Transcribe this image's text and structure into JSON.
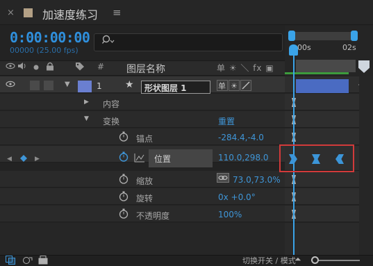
{
  "panel": {
    "close": "×",
    "title": "加速度练习",
    "menu": "≡",
    "timecode": "0:00:00:00",
    "timecode_sub": "00000 (25.00 fps)",
    "search_icon": "search-icon"
  },
  "ruler": {
    "tick_start": "00s",
    "tick_end": "02s"
  },
  "columns": {
    "num": "#",
    "layer_name": "图层名称",
    "switch_icons": "单 ☀ ＼ fx ▣"
  },
  "layer": {
    "number": "1",
    "name": "形状图层 1",
    "label_color": "#6a7fd0"
  },
  "rows": {
    "contents": "内容",
    "transform": "变换",
    "reset": "重置",
    "anchor_label": "锚点",
    "anchor_value": "-284.4,-4.0",
    "position_label": "位置",
    "position_value": "110.0,298.0",
    "scale_label": "缩放",
    "scale_value": "73.0,73.0%",
    "rotation_label": "旋转",
    "rotation_value": "0x +0.0°",
    "opacity_label": "不透明度",
    "opacity_value": "100%"
  },
  "footer": {
    "toggle_label": "切换开关 / 模式"
  },
  "colors": {
    "accent": "#3f96d8",
    "highlight": "#d23a3a",
    "layer_bar": "#4a6bc2"
  }
}
